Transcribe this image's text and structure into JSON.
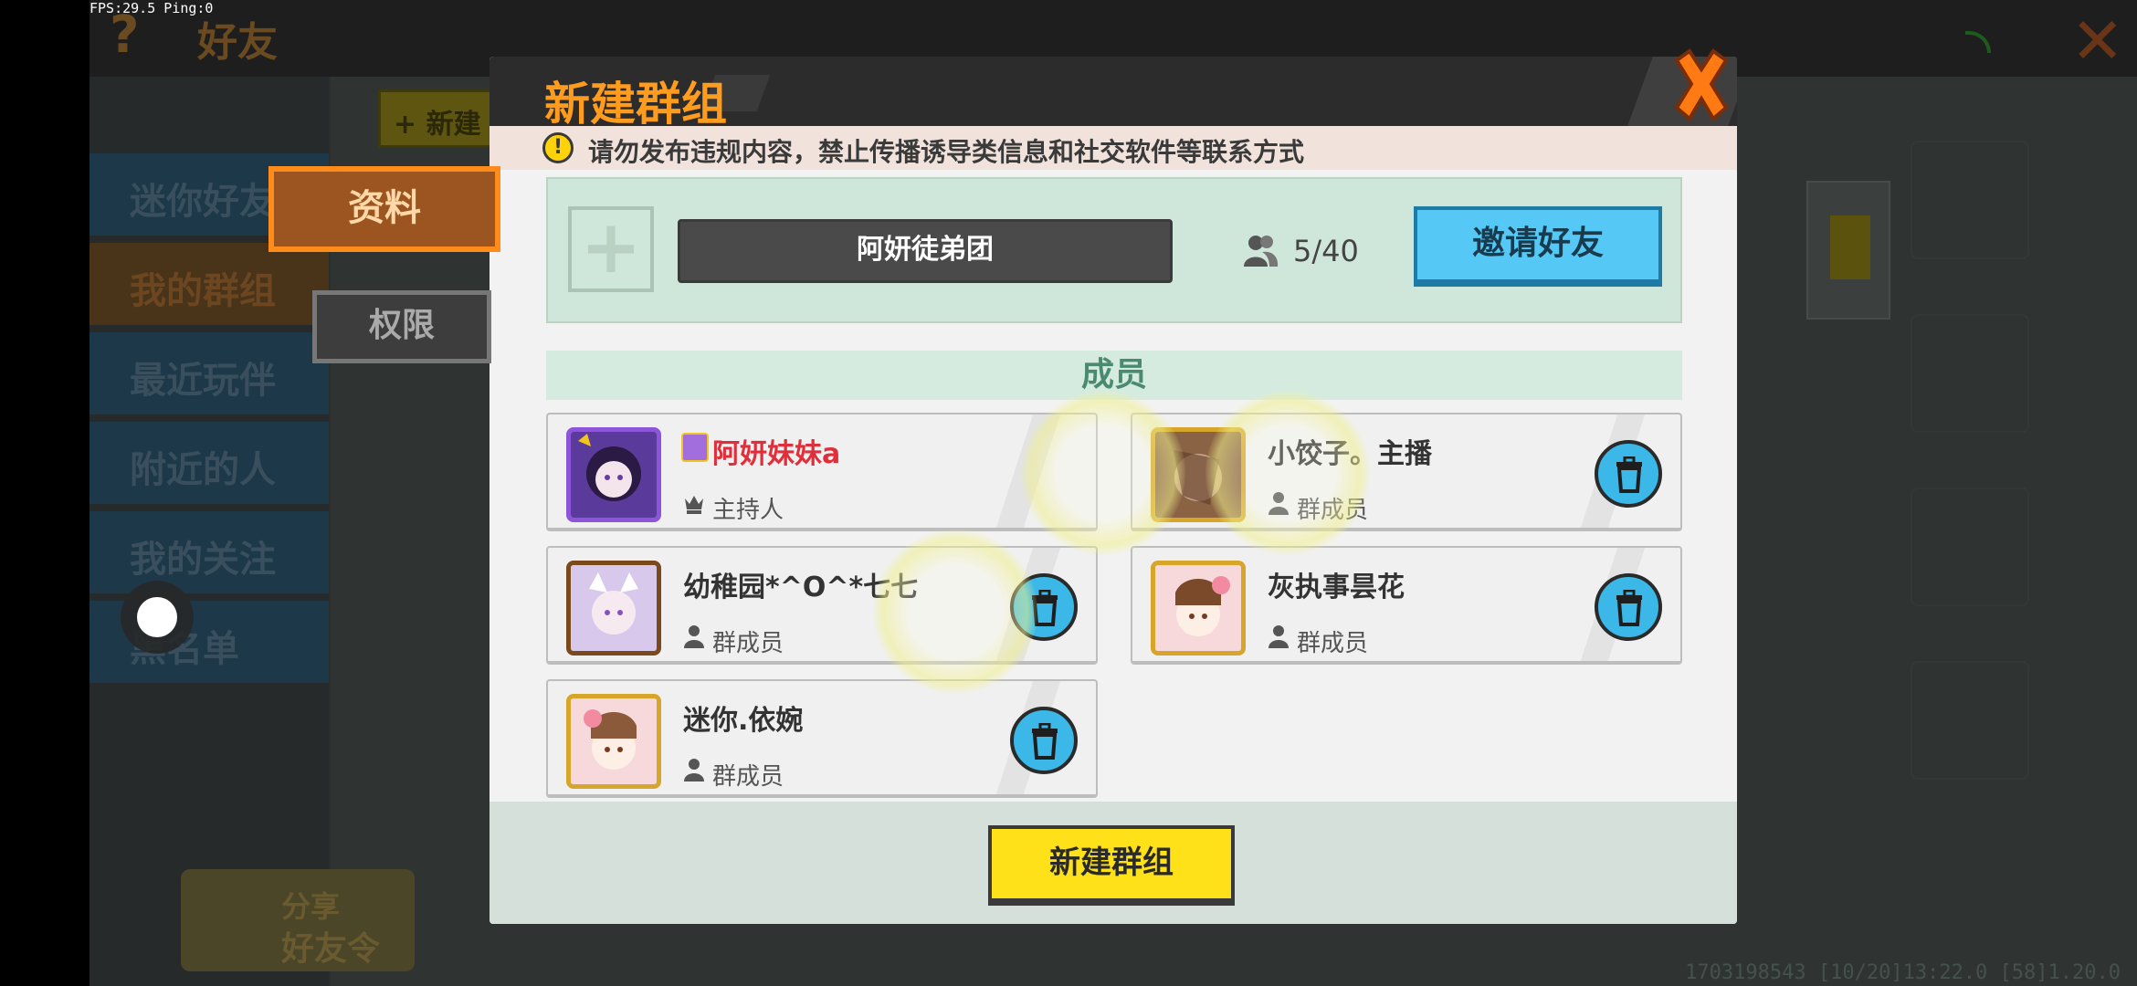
{
  "status": {
    "fps_text": "FPS:29.5  Ping:0"
  },
  "background": {
    "title": "好友",
    "new_group_label": "新建",
    "nav": [
      "迷你好友",
      "我的群组",
      "最近玩伴",
      "附近的人",
      "我的关注",
      "黑名单"
    ],
    "share_line1": "分享",
    "share_line2": "好友令",
    "footer_id": "1703198543  [10/20]13:22.0  [58]1.20.0"
  },
  "side_tabs": {
    "profile": "资料",
    "permissions": "权限"
  },
  "dialog": {
    "title": "新建群组",
    "warning": "请勿发布违规内容，禁止传播诱导类信息和社交软件等联系方式",
    "group_name": "阿妍徒弟团",
    "member_count": "5/40",
    "invite_button": "邀请好友",
    "members_header": "成员",
    "create_button": "新建群组",
    "members": [
      {
        "name": "阿妍妹妹a",
        "role": "主持人",
        "is_host": true
      },
      {
        "name": "小饺子。主播",
        "role": "群成员",
        "is_host": false
      },
      {
        "name": "幼稚园*^O^*七七",
        "role": "群成员",
        "is_host": false
      },
      {
        "name": "灰执事昙花",
        "role": "群成员",
        "is_host": false
      },
      {
        "name": "迷你.依婉",
        "role": "群成员",
        "is_host": false
      }
    ]
  },
  "colors": {
    "title_orange": "#ff9c1e",
    "host_red": "#e02f3a",
    "invite_blue": "#56c8f5",
    "create_yellow": "#ffe11a",
    "delete_blue": "#3bb8e8",
    "close_orange": "#ff7a12"
  },
  "icons": [
    "help-icon",
    "close-icon",
    "wifi-icon",
    "warning-icon",
    "add-icon",
    "people-icon",
    "crown-icon",
    "person-icon",
    "trash-icon"
  ]
}
